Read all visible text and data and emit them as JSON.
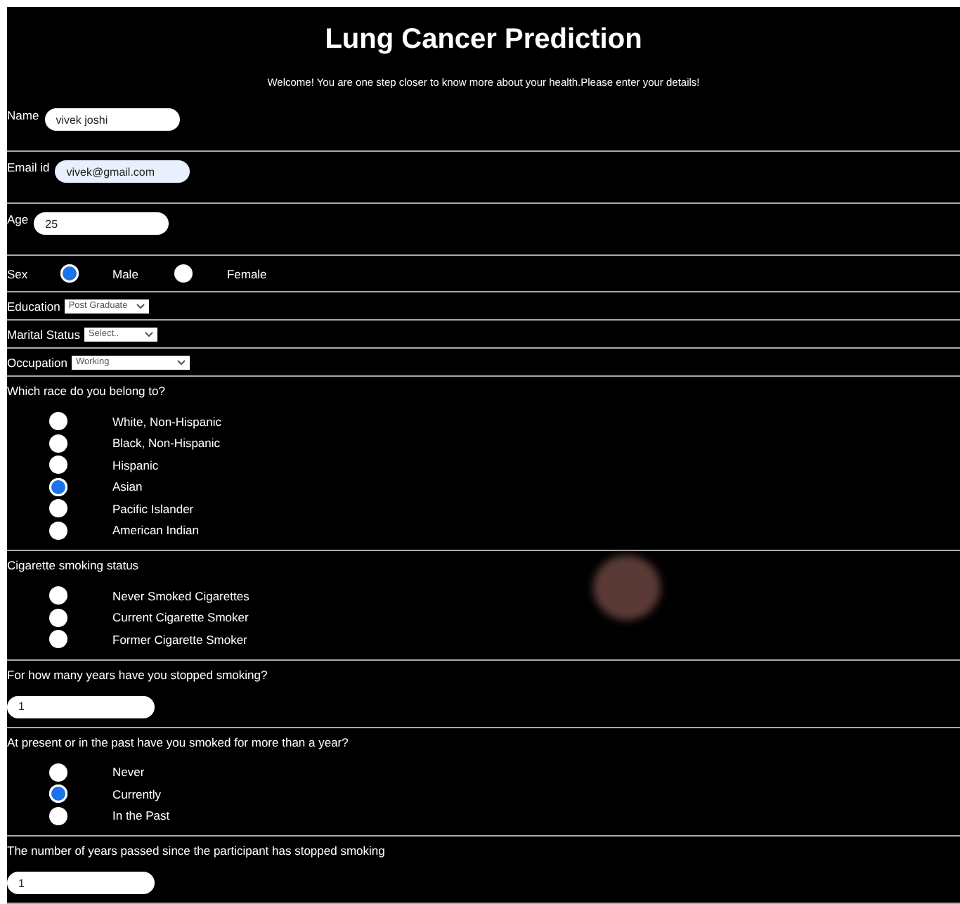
{
  "title": "Lung Cancer Prediction",
  "welcome": "Welcome! You are one step closer to know more about your health.Please enter your details!",
  "fields": [
    {
      "kind": "text",
      "label": "Name",
      "value": "vivek joshi",
      "autofilled": false
    },
    {
      "kind": "text",
      "label": "Email id",
      "value": "vivek@gmail.com",
      "autofilled": true
    },
    {
      "kind": "text",
      "label": "Age",
      "value": "25",
      "autofilled": false
    },
    {
      "kind": "inline-radio",
      "label": "Sex",
      "options": [
        {
          "label": "Male",
          "selected": true
        },
        {
          "label": "Female",
          "selected": false
        }
      ]
    },
    {
      "kind": "select",
      "label": "Education",
      "value": "Post Graduate"
    },
    {
      "kind": "select",
      "label": "Marital Status",
      "value": "Select.."
    },
    {
      "kind": "select",
      "label": "Occupation",
      "value": "Working"
    },
    {
      "kind": "radio-list",
      "label": "Which race do you belong to?",
      "options": [
        {
          "label": "White, Non-Hispanic",
          "selected": false
        },
        {
          "label": "Black, Non-Hispanic",
          "selected": false
        },
        {
          "label": "Hispanic",
          "selected": false
        },
        {
          "label": "Asian",
          "selected": true
        },
        {
          "label": "Pacific Islander",
          "selected": false
        },
        {
          "label": "American Indian",
          "selected": false
        }
      ]
    },
    {
      "kind": "radio-list",
      "label": "Cigarette smoking status",
      "options": [
        {
          "label": "Never Smoked Cigarettes",
          "selected": false
        },
        {
          "label": "Current Cigarette Smoker",
          "selected": false
        },
        {
          "label": "Former Cigarette Smoker",
          "selected": false
        }
      ]
    },
    {
      "kind": "question-input",
      "label": "For how many years have you stopped smoking?",
      "value": "1"
    },
    {
      "kind": "radio-list",
      "label": "At present or in the past have you smoked for more than a year?",
      "options": [
        {
          "label": "Never",
          "selected": false
        },
        {
          "label": "Currently",
          "selected": true
        },
        {
          "label": "In the Past",
          "selected": false
        }
      ]
    },
    {
      "kind": "question-input",
      "label": "The number of years passed since the participant has stopped smoking",
      "value": "1"
    }
  ]
}
